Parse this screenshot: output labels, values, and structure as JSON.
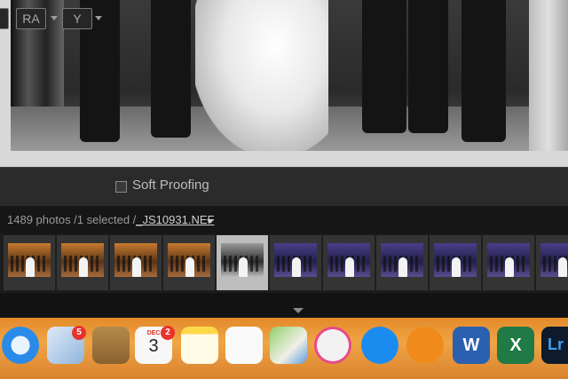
{
  "toolbar": {
    "ra_button": "RA",
    "yyy_button": "Y",
    "soft_proofing_label": "Soft Proofing",
    "soft_proofing_checked": false
  },
  "info": {
    "count_text": "1489 photos /1 selected /",
    "filename": "_JS10931.NEF"
  },
  "filmstrip": {
    "thumbnails": [
      {
        "tone": "warm"
      },
      {
        "tone": "warm"
      },
      {
        "tone": "warm"
      },
      {
        "tone": "warm"
      },
      {
        "tone": "bw",
        "selected": true
      },
      {
        "tone": "cool"
      },
      {
        "tone": "cool"
      },
      {
        "tone": "cool"
      },
      {
        "tone": "cool"
      },
      {
        "tone": "cool"
      },
      {
        "tone": "cool"
      }
    ]
  },
  "dock": {
    "mail_badge": "5",
    "calendar_month": "DEC",
    "calendar_day": "3",
    "calendar_badge": "2",
    "apps": [
      "safari",
      "mail",
      "contacts",
      "calendar",
      "notes",
      "reminders",
      "maps",
      "itunes",
      "app-store",
      "ibooks",
      "word",
      "excel",
      "lightroom"
    ],
    "word_glyph": "W",
    "excel_glyph": "X",
    "lightroom_glyph": "Lr"
  },
  "colors": {
    "dock": "#f0a545",
    "badge": "#e8342c",
    "selected_cell": "#bdbdbd"
  }
}
